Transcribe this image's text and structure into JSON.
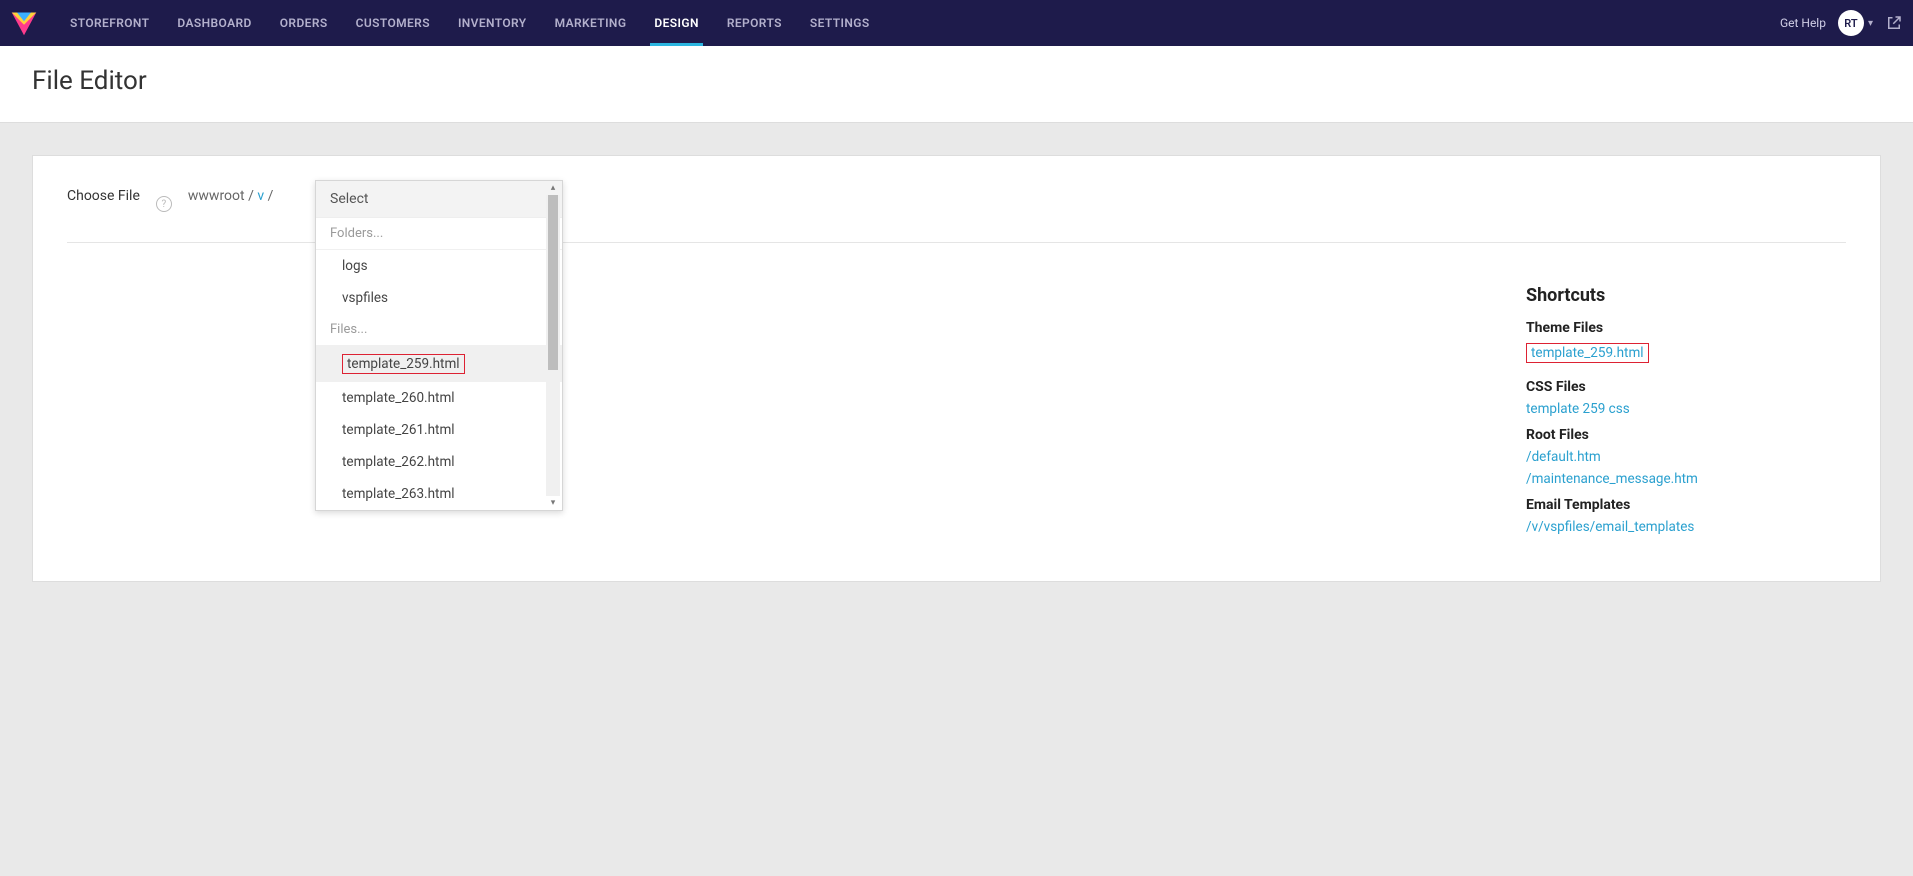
{
  "topbar": {
    "nav": [
      "STOREFRONT",
      "DASHBOARD",
      "ORDERS",
      "CUSTOMERS",
      "INVENTORY",
      "MARKETING",
      "DESIGN",
      "REPORTS",
      "SETTINGS"
    ],
    "active_index": 6,
    "gethelp": "Get Help",
    "avatar": "RT"
  },
  "page": {
    "title": "File Editor"
  },
  "chooser": {
    "label": "Choose File",
    "crumbs_root": "wwwroot",
    "crumbs_v": "v",
    "crumbs_sep": " / "
  },
  "dropdown": {
    "select_label": "Select",
    "folders_label": "Folders...",
    "folders": [
      "logs",
      "vspfiles"
    ],
    "files_label": "Files...",
    "files": [
      "template_259.html",
      "template_260.html",
      "template_261.html",
      "template_262.html",
      "template_263.html"
    ],
    "selected_file_index": 0
  },
  "shortcuts": {
    "title": "Shortcuts",
    "groups": [
      {
        "label": "Theme Files",
        "links": [
          "template_259.html"
        ],
        "boxed_index": 0
      },
      {
        "label": "CSS Files",
        "links": [
          "template 259 css"
        ]
      },
      {
        "label": "Root Files",
        "links": [
          "/default.htm",
          "/maintenance_message.htm"
        ]
      },
      {
        "label": "Email Templates",
        "links": [
          "/v/vspfiles/email_templates"
        ]
      }
    ]
  }
}
